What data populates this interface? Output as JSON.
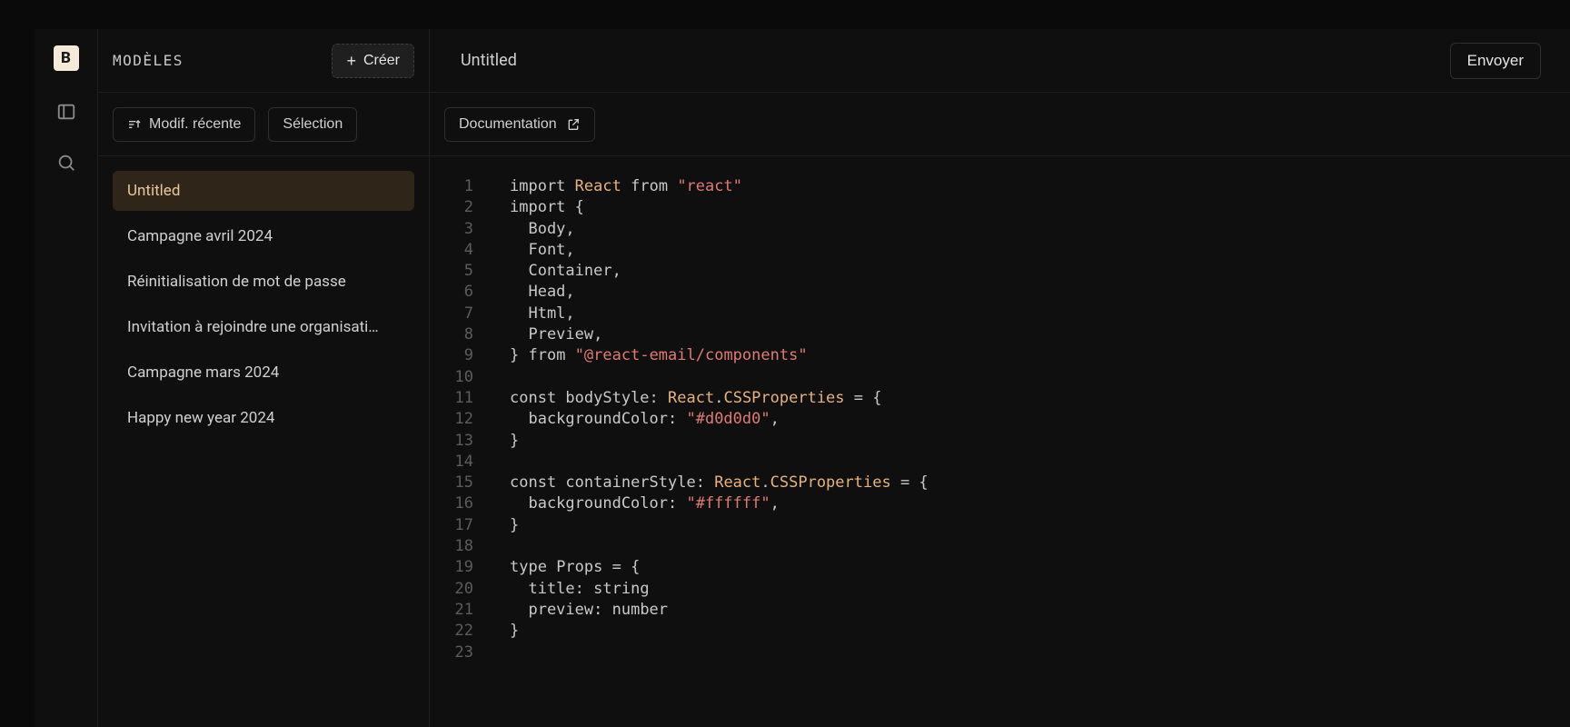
{
  "brand": {
    "logo_letter": "B"
  },
  "sidebar": {
    "title": "MODÈLES",
    "create_label": "Créer",
    "sort_label": "Modif. récente",
    "select_label": "Sélection",
    "items": [
      {
        "label": "Untitled",
        "selected": true
      },
      {
        "label": "Campagne avril 2024",
        "selected": false
      },
      {
        "label": "Réinitialisation de mot de passe",
        "selected": false
      },
      {
        "label": "Invitation à rejoindre une organisati…",
        "selected": false
      },
      {
        "label": "Campagne mars 2024",
        "selected": false
      },
      {
        "label": "Happy new year 2024",
        "selected": false
      }
    ]
  },
  "main": {
    "title": "Untitled",
    "send_label": "Envoyer",
    "docs_label": "Documentation"
  },
  "editor": {
    "line_start": 1,
    "line_end": 23,
    "lines": [
      [
        {
          "t": "key",
          "v": "import"
        },
        {
          "t": "p",
          "v": " "
        },
        {
          "t": "id",
          "v": "React"
        },
        {
          "t": "p",
          "v": " "
        },
        {
          "t": "key",
          "v": "from"
        },
        {
          "t": "p",
          "v": " "
        },
        {
          "t": "str",
          "v": "\"react\""
        }
      ],
      [
        {
          "t": "key",
          "v": "import"
        },
        {
          "t": "p",
          "v": " {"
        }
      ],
      [
        {
          "t": "p",
          "v": "  Body,"
        }
      ],
      [
        {
          "t": "p",
          "v": "  Font,"
        }
      ],
      [
        {
          "t": "p",
          "v": "  Container,"
        }
      ],
      [
        {
          "t": "p",
          "v": "  Head,"
        }
      ],
      [
        {
          "t": "p",
          "v": "  Html,"
        }
      ],
      [
        {
          "t": "p",
          "v": "  Preview,"
        }
      ],
      [
        {
          "t": "p",
          "v": "} "
        },
        {
          "t": "key",
          "v": "from"
        },
        {
          "t": "p",
          "v": " "
        },
        {
          "t": "str",
          "v": "\"@react-email/components\""
        }
      ],
      [],
      [
        {
          "t": "key",
          "v": "const"
        },
        {
          "t": "p",
          "v": " bodyStyle"
        },
        {
          "t": "punct",
          "v": ": "
        },
        {
          "t": "type",
          "v": "React"
        },
        {
          "t": "p",
          "v": "."
        },
        {
          "t": "type",
          "v": "CSSProperties"
        },
        {
          "t": "p",
          "v": " = {"
        }
      ],
      [
        {
          "t": "p",
          "v": "  backgroundColor"
        },
        {
          "t": "punct",
          "v": ": "
        },
        {
          "t": "str",
          "v": "\"#d0d0d0\""
        },
        {
          "t": "p",
          "v": ","
        }
      ],
      [
        {
          "t": "p",
          "v": "}"
        }
      ],
      [],
      [
        {
          "t": "key",
          "v": "const"
        },
        {
          "t": "p",
          "v": " containerStyle"
        },
        {
          "t": "punct",
          "v": ": "
        },
        {
          "t": "type",
          "v": "React"
        },
        {
          "t": "p",
          "v": "."
        },
        {
          "t": "type",
          "v": "CSSProperties"
        },
        {
          "t": "p",
          "v": " = {"
        }
      ],
      [
        {
          "t": "p",
          "v": "  backgroundColor"
        },
        {
          "t": "punct",
          "v": ": "
        },
        {
          "t": "str",
          "v": "\"#ffffff\""
        },
        {
          "t": "p",
          "v": ","
        }
      ],
      [
        {
          "t": "p",
          "v": "}"
        }
      ],
      [],
      [
        {
          "t": "key",
          "v": "type"
        },
        {
          "t": "p",
          "v": " Props = {"
        }
      ],
      [
        {
          "t": "p",
          "v": "  title"
        },
        {
          "t": "punct",
          "v": ": "
        },
        {
          "t": "p",
          "v": "string"
        }
      ],
      [
        {
          "t": "p",
          "v": "  preview"
        },
        {
          "t": "punct",
          "v": ": "
        },
        {
          "t": "p",
          "v": "number"
        }
      ],
      [
        {
          "t": "p",
          "v": "}"
        }
      ],
      []
    ]
  }
}
